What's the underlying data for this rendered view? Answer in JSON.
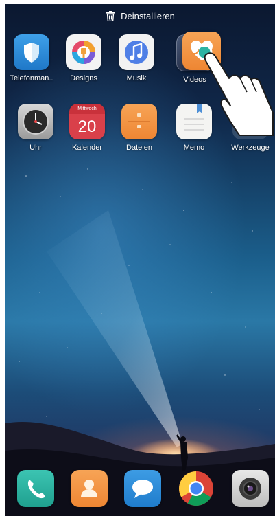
{
  "topbar": {
    "uninstall_label": "Deinstallieren"
  },
  "row1": [
    {
      "label": "Telefonman..",
      "icon": "shield-icon"
    },
    {
      "label": "Designs",
      "icon": "paintbrush-icon"
    },
    {
      "label": "Musik",
      "icon": "music-note-icon"
    },
    {
      "label": "Videos",
      "icon": "video-icon"
    }
  ],
  "row2": [
    {
      "label": "Uhr",
      "icon": "clock-icon"
    },
    {
      "label": "Kalender",
      "icon": "calendar-icon",
      "weekday": "Mittwoch",
      "day": "20"
    },
    {
      "label": "Dateien",
      "icon": "folder-icon"
    },
    {
      "label": "Memo",
      "icon": "notepad-icon"
    },
    {
      "label": "Werkzeuge",
      "icon": "tools-folder-icon"
    }
  ],
  "dragged_app": {
    "icon": "heart-health-icon"
  },
  "dock": [
    {
      "icon": "phone-icon"
    },
    {
      "icon": "contacts-icon"
    },
    {
      "icon": "messages-icon"
    },
    {
      "icon": "chrome-icon"
    },
    {
      "icon": "camera-icon"
    }
  ],
  "colors": {
    "accent_teal": "#2bb3a3",
    "folder_orange": "#f0913d",
    "calendar_red": "#d9404a"
  }
}
